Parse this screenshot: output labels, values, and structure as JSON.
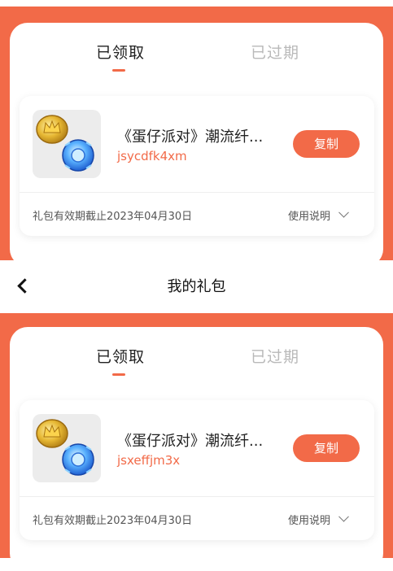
{
  "header": {
    "title": "我的礼包"
  },
  "tabs": [
    {
      "label": "已领取",
      "active": true
    },
    {
      "label": "已过期",
      "active": false
    }
  ],
  "gift_cards": [
    {
      "title": "《蛋仔派对》潮流纤...",
      "code": "jsycdfk4xm",
      "copy_label": "复制",
      "expiry": "礼包有效期截止2023年04月30日",
      "help_label": "使用说明"
    },
    {
      "title": "《蛋仔派对》潮流纤...",
      "code": "jsxeffjm3x",
      "copy_label": "复制",
      "expiry": "礼包有效期截止2023年04月30日",
      "help_label": "使用说明"
    }
  ],
  "colors": {
    "accent": "#f26a48",
    "inactive_tab": "#b9b9b9"
  },
  "icons": {
    "back": "chevron-left-icon",
    "expand": "chevron-down-icon",
    "gift": "crown-coin-and-gem-icon"
  }
}
